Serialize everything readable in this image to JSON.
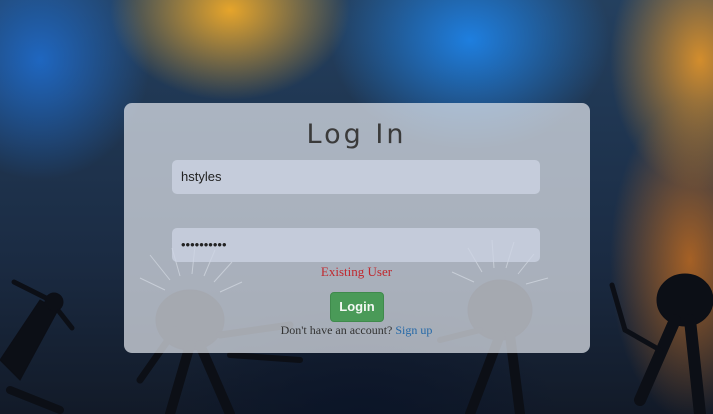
{
  "form": {
    "title": "Log In",
    "username_value": "hstyles",
    "password_value": "••••••••••",
    "error_message": "Existing User",
    "login_button": "Login",
    "signup_prompt": "Don't have an account?",
    "signup_link": "Sign up"
  },
  "colors": {
    "error": "#c0282e",
    "button": "#4a9a58",
    "link": "#2468a8"
  }
}
